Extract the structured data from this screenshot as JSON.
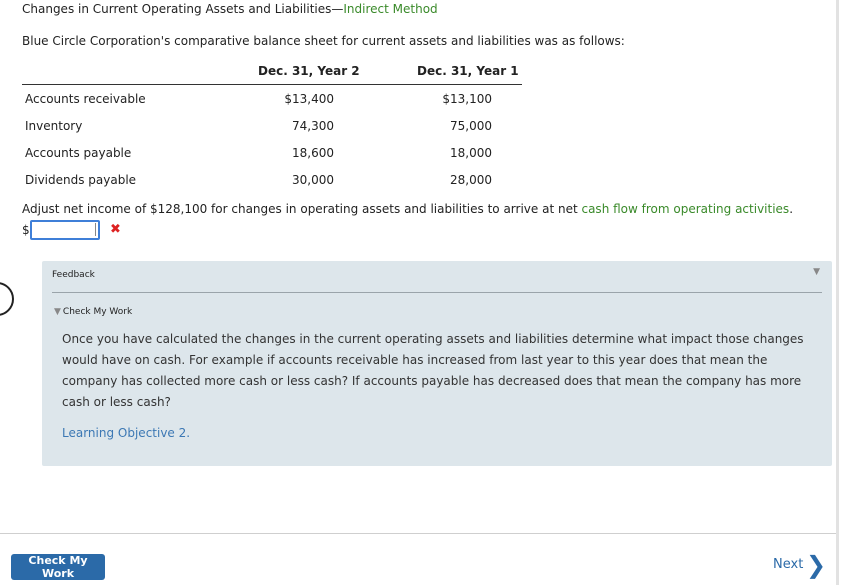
{
  "header": {
    "title_main": "Changes in Current Operating Assets and Liabilities—",
    "title_method": "Indirect Method"
  },
  "intro": "Blue Circle Corporation's comparative balance sheet for current assets and liabilities was as follows:",
  "table": {
    "columns": [
      "Dec. 31, Year 2",
      "Dec. 31, Year 1"
    ],
    "rows": [
      {
        "label": "Accounts receivable",
        "year2": "$13,400",
        "year1": "$13,100"
      },
      {
        "label": "Inventory",
        "year2": "74,300",
        "year1": "75,000"
      },
      {
        "label": "Accounts payable",
        "year2": "18,600",
        "year1": "18,000"
      },
      {
        "label": "Dividends payable",
        "year2": "30,000",
        "year1": "28,000"
      }
    ]
  },
  "question": {
    "text": "Adjust net income of $128,100 for changes in operating assets and liabilities to arrive at net ",
    "link": "cash flow from operating activities",
    "end": "."
  },
  "answer": {
    "currency": "$",
    "value": "",
    "status_mark": "✖"
  },
  "feedback": {
    "label": "Feedback",
    "toggle_icon": "▼",
    "section_icon": "▼",
    "section_label": "Check My Work",
    "text": "Once you have calculated the changes in the current operating assets and liabilities determine what impact those changes would have on cash. For example if accounts receivable has increased from last year to this year does that mean the company has collected more cash or less cash? If accounts payable has decreased does that mean the company has more cash or less cash?",
    "link": "Learning Objective 2."
  },
  "footer": {
    "check_button": "Check My Work",
    "next_label": "Next",
    "next_icon": "❯"
  },
  "colors": {
    "accent_green": "#3a8a2a",
    "link_blue": "#2b6aa8",
    "error_red": "#d22222",
    "panel_bg": "#dde6eb"
  }
}
